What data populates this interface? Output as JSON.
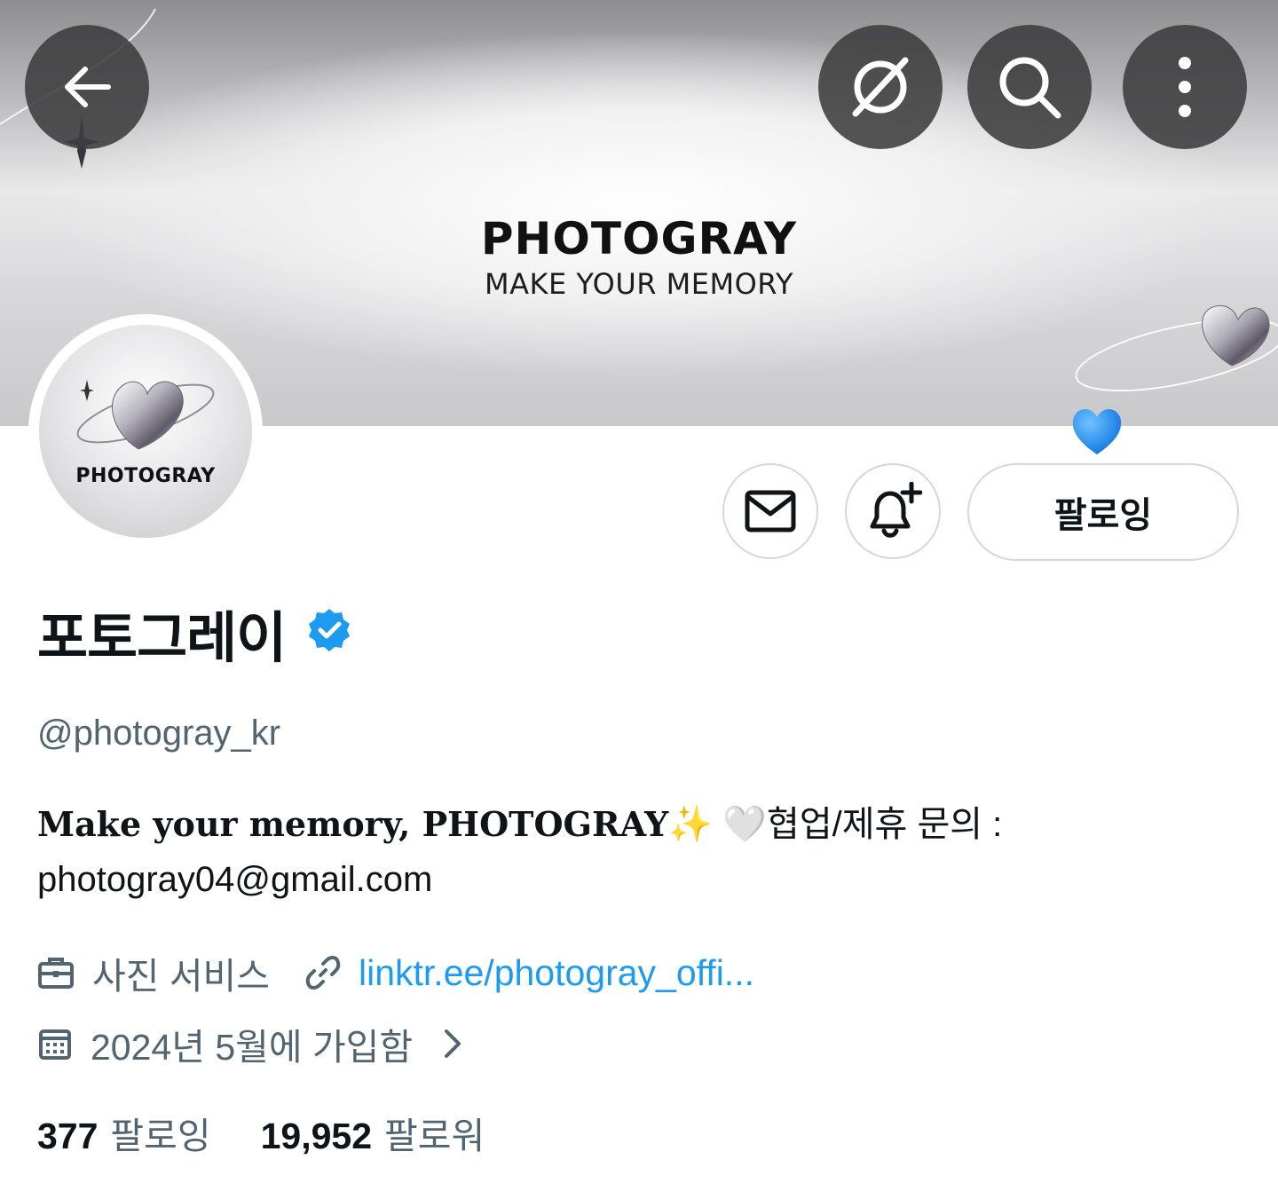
{
  "banner": {
    "title": "PHOTOGRAY",
    "subtitle": "MAKE YOUR MEMORY"
  },
  "avatar": {
    "label": "PHOTOGRAY"
  },
  "actions": {
    "follow_label": "팔로잉"
  },
  "profile": {
    "display_name": "포토그레이",
    "handle": "@photogray_kr",
    "bio_line1_strong": "Make your memory, PHOTOGRAY",
    "bio_sparkle": "✨",
    "bio_line1_rest": "🤍협업/제휴 문의 :",
    "bio_line2": "photogray04@gmail.com",
    "category": "사진 서비스",
    "link": "linktr.ee/photogray_offi...",
    "joined": "2024년 5월에 가입함"
  },
  "stats": {
    "following_count": "377",
    "following_label": "팔로잉",
    "followers_count": "19,952",
    "followers_label": "팔로워"
  },
  "colors": {
    "accent": "#1d9bf0",
    "secondary_text": "#536471",
    "primary_text": "#0f1419",
    "verified": "#1d9bf0"
  },
  "icons": [
    "back-arrow-icon",
    "grok-icon",
    "search-icon",
    "more-vertical-icon",
    "mail-icon",
    "bell-plus-icon",
    "verified-badge-icon",
    "briefcase-icon",
    "link-icon",
    "calendar-icon",
    "chevron-right-icon"
  ]
}
